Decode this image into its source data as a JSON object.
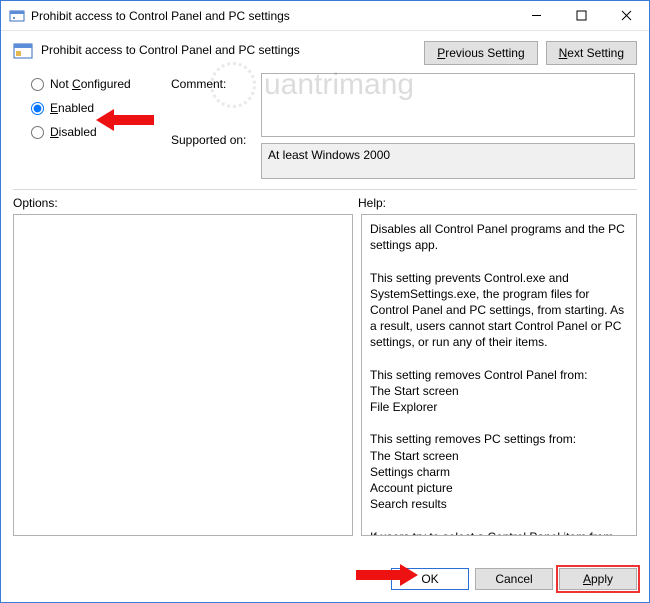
{
  "titlebar": {
    "title": "Prohibit access to Control Panel and PC settings"
  },
  "subheader": {
    "title": "Prohibit access to Control Panel and PC settings",
    "prev_label_pre": "",
    "prev_underline": "P",
    "prev_label_post": "revious Setting",
    "next_underline": "N",
    "next_label_post": "ext Setting"
  },
  "radios": {
    "not_configured_pre": "Not ",
    "not_configured_u": "C",
    "not_configured_post": "onfigured",
    "enabled_u": "E",
    "enabled_post": "nabled",
    "disabled_u": "D",
    "disabled_post": "isabled",
    "selected": "enabled"
  },
  "labels": {
    "comment": "Comment:",
    "supported": "Supported on:",
    "options": "Options:",
    "help": "Help:"
  },
  "fields": {
    "comment_value": "",
    "supported_text": "At least Windows 2000"
  },
  "help_text": "Disables all Control Panel programs and the PC settings app.\n\nThis setting prevents Control.exe and SystemSettings.exe, the program files for Control Panel and PC settings, from starting. As a result, users cannot start Control Panel or PC settings, or run any of their items.\n\nThis setting removes Control Panel from:\nThe Start screen\nFile Explorer\n\nThis setting removes PC settings from:\nThe Start screen\nSettings charm\nAccount picture\nSearch results\n\nIf users try to select a Control Panel item from the Properties item on a context menu, a message appears explaining that a setting prevents the action.",
  "footer": {
    "ok": "OK",
    "cancel": "Cancel",
    "apply_u": "A",
    "apply_post": "pply"
  },
  "watermark": {
    "text": "uantrimang"
  }
}
